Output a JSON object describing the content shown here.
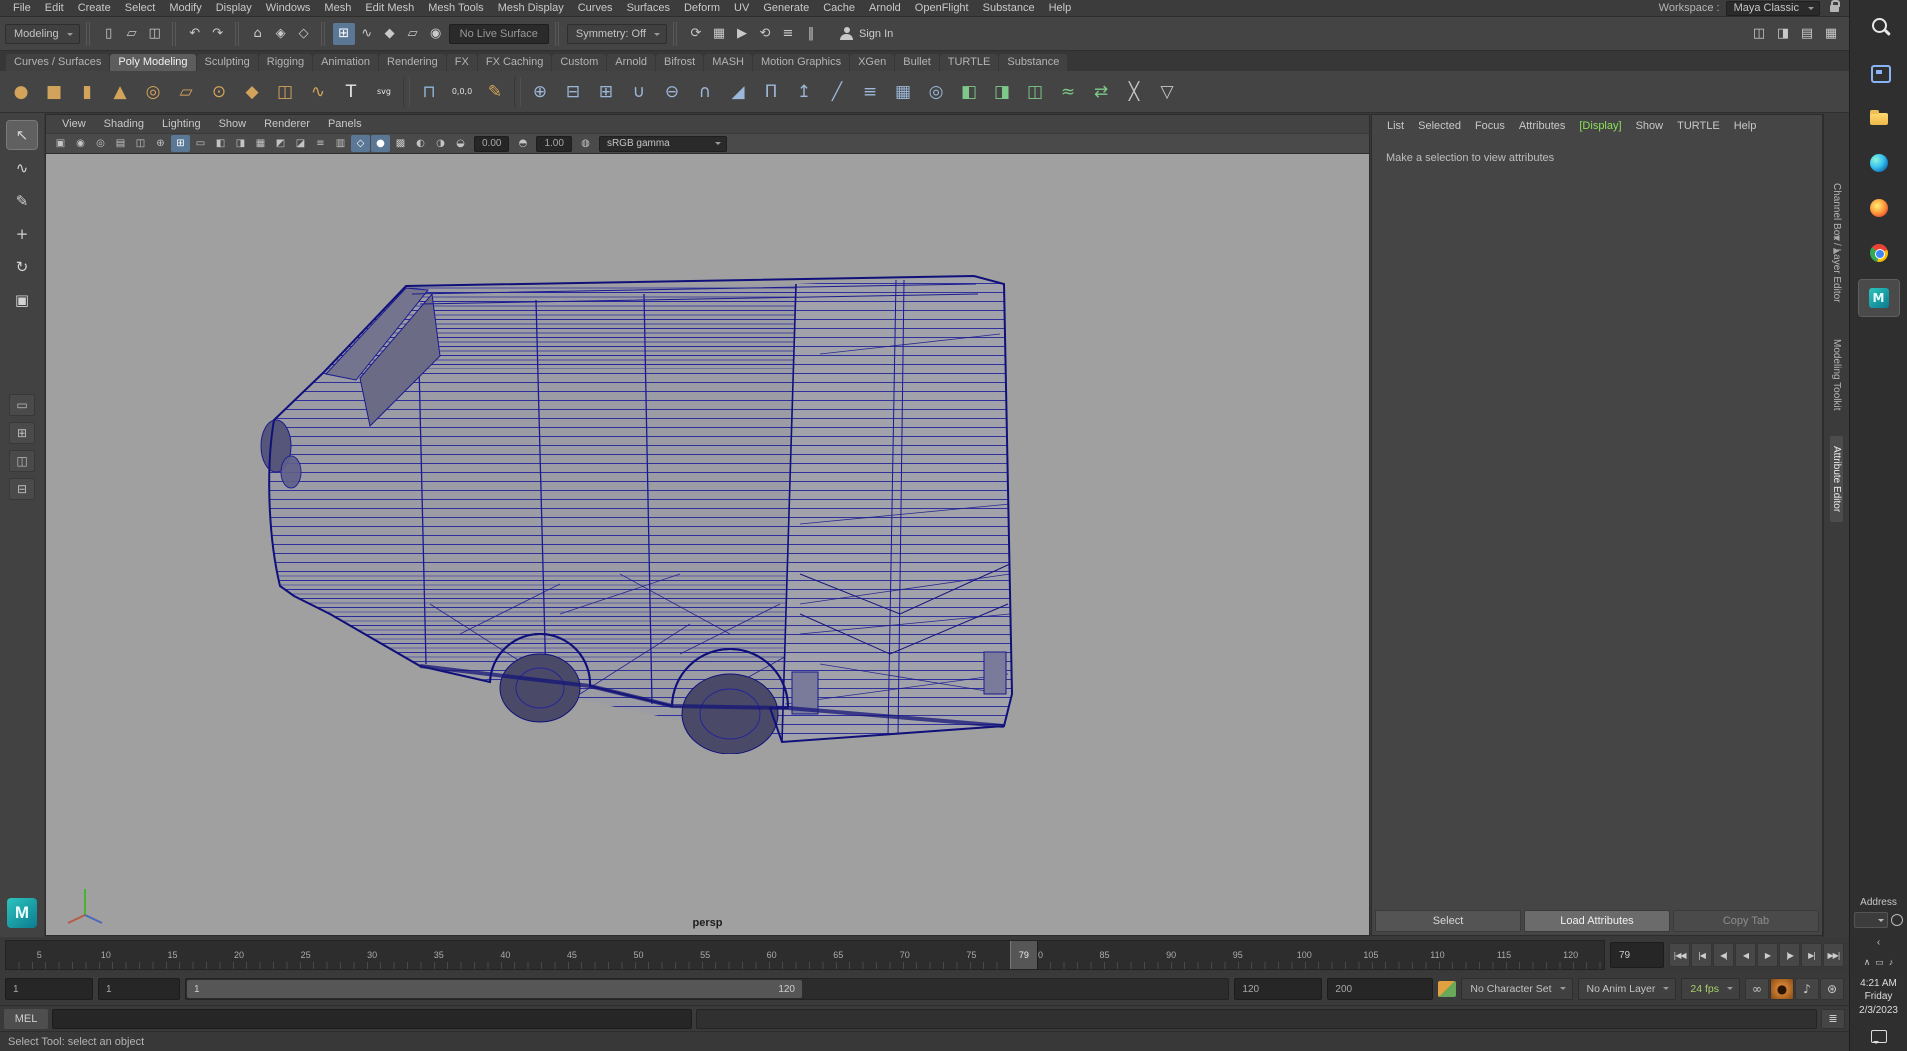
{
  "window": {
    "help_line": "Select Tool: select an object"
  },
  "menu_bar": {
    "items": [
      "File",
      "Edit",
      "Create",
      "Select",
      "Modify",
      "Display",
      "Windows",
      "Mesh",
      "Edit Mesh",
      "Mesh Tools",
      "Mesh Display",
      "Curves",
      "Surfaces",
      "Deform",
      "UV",
      "Generate",
      "Cache",
      "Arnold",
      "OpenFlight",
      "Substance",
      "Help"
    ],
    "workspace_label": "Workspace :",
    "workspace_value": "Maya Classic"
  },
  "status_line": {
    "mode": "Modeling",
    "file_icons": [
      {
        "name": "new-scene-icon",
        "g": "▯"
      },
      {
        "name": "open-scene-icon",
        "g": "▱"
      },
      {
        "name": "save-scene-icon",
        "g": "◫"
      }
    ],
    "history_icons": [
      {
        "name": "undo-icon",
        "g": "↶"
      },
      {
        "name": "redo-icon",
        "g": "↷"
      }
    ],
    "selection_icons": [
      {
        "name": "select-hierarchy-icon",
        "g": "⌂"
      },
      {
        "name": "select-object-icon",
        "g": "◈"
      },
      {
        "name": "select-component-icon",
        "g": "◇"
      }
    ],
    "snap_icons": [
      {
        "name": "snap-grid-icon",
        "g": "⊞",
        "cls": "on"
      },
      {
        "name": "snap-curve-icon",
        "g": "∿"
      },
      {
        "name": "snap-point-icon",
        "g": "◆"
      },
      {
        "name": "snap-plane-icon",
        "g": "▱"
      },
      {
        "name": "make-live-icon",
        "g": "◉"
      }
    ],
    "live_surface": "No Live Surface",
    "symmetry": "Symmetry: Off",
    "render_icons": [
      {
        "name": "construction-history-icon",
        "g": "⟳"
      },
      {
        "name": "render-view-icon",
        "g": "▦"
      },
      {
        "name": "render-frame-icon",
        "g": "▶"
      },
      {
        "name": "ipr-render-icon",
        "g": "⟲"
      },
      {
        "name": "render-settings-icon",
        "g": "≡"
      },
      {
        "name": "pause-icon",
        "g": "‖"
      }
    ],
    "sign_in": "Sign In",
    "panel_toggles": [
      {
        "name": "toggle-modeling-toolkit-icon",
        "g": "◫"
      },
      {
        "name": "toggle-attribute-editor-icon",
        "g": "◨"
      },
      {
        "name": "toggle-tool-settings-icon",
        "g": "▤"
      },
      {
        "name": "toggle-channel-box-icon",
        "g": "▦"
      }
    ]
  },
  "shelf": {
    "tabs": [
      {
        "label": "Curves / Surfaces"
      },
      {
        "label": "Poly Modeling",
        "cls": "active"
      },
      {
        "label": "Sculpting"
      },
      {
        "label": "Rigging"
      },
      {
        "label": "Animation"
      },
      {
        "label": "Rendering"
      },
      {
        "label": "FX"
      },
      {
        "label": "FX Caching"
      },
      {
        "label": "Custom"
      },
      {
        "label": "Arnold"
      },
      {
        "label": "Bifrost"
      },
      {
        "label": "MASH"
      },
      {
        "label": "Motion Graphics"
      },
      {
        "label": "XGen"
      },
      {
        "label": "Bullet"
      },
      {
        "label": "TURTLE"
      },
      {
        "label": "Substance"
      }
    ],
    "items": [
      {
        "name": "poly-sphere-icon",
        "g": "●",
        "c": "#d2a35b"
      },
      {
        "name": "poly-cube-icon",
        "g": "■",
        "c": "#d2a35b"
      },
      {
        "name": "poly-cylinder-icon",
        "g": "▮",
        "c": "#d2a35b"
      },
      {
        "name": "poly-cone-icon",
        "g": "▲",
        "c": "#d2a35b"
      },
      {
        "name": "poly-torus-icon",
        "g": "◎",
        "c": "#d2a35b"
      },
      {
        "name": "poly-plane-icon",
        "g": "▱",
        "c": "#d2a35b"
      },
      {
        "name": "poly-disc-icon",
        "g": "⊙",
        "c": "#d2a35b"
      },
      {
        "name": "poly-platonic-icon",
        "g": "◆",
        "c": "#d2a35b"
      },
      {
        "name": "poly-pipe-icon",
        "g": "◫",
        "c": "#d2a35b"
      },
      {
        "name": "poly-helix-icon",
        "g": "∿",
        "c": "#d2a35b"
      },
      {
        "name": "type-tool-icon",
        "g": "T",
        "c": "#e8e8e8"
      },
      {
        "name": "svg-tool-icon",
        "g": "svg",
        "c": "#e8e8e8",
        "cls": "txt"
      },
      {
        "name": "shelf-separator",
        "g": "",
        "cls": "sepi"
      },
      {
        "name": "make-live-shelf-icon",
        "g": "⊓",
        "c": "#8fb6da"
      },
      {
        "name": "move-to-origin-icon",
        "g": "0,0,0",
        "c": "#e0e0e0",
        "cls": "txt"
      },
      {
        "name": "sculpt-tool-icon",
        "g": "✎",
        "c": "#d2a35b"
      },
      {
        "name": "shelf-separator",
        "g": "",
        "cls": "sepi"
      },
      {
        "name": "combine-icon",
        "g": "⊕",
        "c": "#9db7d8"
      },
      {
        "name": "separate-icon",
        "g": "⊟",
        "c": "#9db7d8"
      },
      {
        "name": "extract-icon",
        "g": "⊞",
        "c": "#9db7d8"
      },
      {
        "name": "boolean-union-icon",
        "g": "∪",
        "c": "#9db7d8"
      },
      {
        "name": "boolean-difference-icon",
        "g": "⊖",
        "c": "#9db7d8"
      },
      {
        "name": "boolean-intersection-icon",
        "g": "∩",
        "c": "#9db7d8"
      },
      {
        "name": "bevel-icon",
        "g": "◢",
        "c": "#9db7d8"
      },
      {
        "name": "bridge-icon",
        "g": "Π",
        "c": "#9db7d8"
      },
      {
        "name": "extrude-icon",
        "g": "↥",
        "c": "#9db7d8"
      },
      {
        "name": "multi-cut-icon",
        "g": "╱",
        "c": "#9db7d8"
      },
      {
        "name": "connect-icon",
        "g": "≡",
        "c": "#9db7d8"
      },
      {
        "name": "quad-draw-icon",
        "g": "▦",
        "c": "#9db7d8"
      },
      {
        "name": "target-weld-icon",
        "g": "◎",
        "c": "#9db7d8"
      },
      {
        "name": "mirror-icon",
        "g": "◧",
        "c": "#7ec98a"
      },
      {
        "name": "flip-icon",
        "g": "◨",
        "c": "#7ec98a"
      },
      {
        "name": "symmetrize-icon",
        "g": "◫",
        "c": "#7ec98a"
      },
      {
        "name": "average-vertices-icon",
        "g": "≈",
        "c": "#7ec98a"
      },
      {
        "name": "transfer-attributes-icon",
        "g": "⇄",
        "c": "#7ec98a"
      },
      {
        "name": "crease-tool-icon",
        "g": "╳",
        "c": "#c8c8c8"
      },
      {
        "name": "reduce-icon",
        "g": "▽",
        "c": "#c8c8c8"
      }
    ]
  },
  "toolbox": {
    "tools": [
      {
        "name": "select-tool",
        "g": "↖",
        "cls": "active"
      },
      {
        "name": "lasso-tool",
        "g": "∿"
      },
      {
        "name": "paint-select-tool",
        "g": "✎"
      },
      {
        "name": "move-tool",
        "g": "+"
      },
      {
        "name": "rotate-tool",
        "g": "↻"
      },
      {
        "name": "scale-tool",
        "g": "▣"
      }
    ],
    "layouts": [
      {
        "name": "layout-single-pane",
        "g": "▭"
      },
      {
        "name": "layout-four-pane",
        "g": "⊞"
      },
      {
        "name": "layout-persp-outliner",
        "g": "◫"
      },
      {
        "name": "layout-stacked",
        "g": "⊟"
      }
    ]
  },
  "panel": {
    "menus": [
      "View",
      "Shading",
      "Lighting",
      "Show",
      "Renderer",
      "Panels"
    ],
    "icons": [
      {
        "name": "select-camera-icon",
        "g": "▣"
      },
      {
        "name": "lock-camera-icon",
        "g": "◉"
      },
      {
        "name": "camera-attributes-icon",
        "g": "◎"
      },
      {
        "name": "bookmarks-icon",
        "g": "▤"
      },
      {
        "name": "image-plane-icon",
        "g": "◫"
      },
      {
        "name": "pan-zoom-icon",
        "g": "⊕"
      },
      {
        "name": "grid-icon",
        "g": "⊞",
        "cls": "on"
      },
      {
        "name": "film-gate-icon",
        "g": "▭"
      },
      {
        "name": "resolution-gate-icon",
        "g": "◧"
      },
      {
        "name": "gate-mask-icon",
        "g": "◨"
      },
      {
        "name": "field-chart-icon",
        "g": "▦"
      },
      {
        "name": "safe-action-icon",
        "g": "◩"
      },
      {
        "name": "safe-title-icon",
        "g": "◪"
      },
      {
        "name": "hud-icon",
        "g": "≡"
      },
      {
        "name": "xray-icon",
        "g": "▥"
      },
      {
        "name": "wireframe-display-icon",
        "g": "◇",
        "cls": "on"
      },
      {
        "name": "shaded-display-icon",
        "g": "●",
        "cls": "on"
      },
      {
        "name": "textured-display-icon",
        "g": "▩"
      },
      {
        "name": "lights-icon",
        "g": "◐"
      },
      {
        "name": "shadows-icon",
        "g": "◑"
      }
    ],
    "exposure_icon": "◒",
    "exposure": "0.00",
    "gamma_icon": "◓",
    "gamma": "1.00",
    "cm_icon": "◍",
    "view_transform": "sRGB gamma",
    "camera": "persp"
  },
  "attribute_editor": {
    "tabs": [
      {
        "label": "List"
      },
      {
        "label": "Selected"
      },
      {
        "label": "Focus"
      },
      {
        "label": "Attributes"
      },
      {
        "label": "[Display]",
        "cls": "green"
      },
      {
        "label": "Show"
      },
      {
        "label": "TURTLE"
      },
      {
        "label": "Help"
      }
    ],
    "message": "Make a selection to view attributes",
    "buttons": [
      {
        "label": "Select",
        "name": "select-button"
      },
      {
        "label": "Load Attributes",
        "name": "load-attributes-button",
        "cls": "primary"
      },
      {
        "label": "Copy Tab",
        "name": "copy-tab-button",
        "cls": "disabled"
      }
    ]
  },
  "side_tabs": [
    {
      "label": "Channel Box / Layer Editor",
      "name": "tab-channel-box-layer-editor"
    },
    {
      "label": "Modeling Toolkit",
      "name": "tab-modeling-toolkit"
    },
    {
      "label": "Attribute Editor",
      "name": "tab-attribute-editor",
      "cls": "active"
    }
  ],
  "timeline": {
    "ticks": [
      5,
      10,
      15,
      20,
      25,
      30,
      35,
      40,
      45,
      50,
      55,
      60,
      65,
      70,
      75,
      80,
      85,
      90,
      95,
      100,
      105,
      110,
      115,
      120
    ],
    "current": "79",
    "playback": [
      {
        "name": "go-to-start-button",
        "g": "|◀◀"
      },
      {
        "name": "step-back-frame-button",
        "g": "|◀"
      },
      {
        "name": "step-back-key-button",
        "g": "◀|"
      },
      {
        "name": "play-backwards-button",
        "g": "◀"
      },
      {
        "name": "play-forward-button",
        "g": "▶"
      },
      {
        "name": "step-forward-key-button",
        "g": "|▶"
      },
      {
        "name": "step-forward-frame-button",
        "g": "▶|"
      },
      {
        "name": "go-to-end-button",
        "g": "▶▶|"
      }
    ]
  },
  "range_slider": {
    "anim_start": "1",
    "play_start": "1",
    "bar_start": "1",
    "bar_end": "120",
    "play_end": "120",
    "anim_end": "200",
    "character_set": "No Character Set",
    "anim_layer": "No Anim Layer",
    "fps": "24 fps",
    "icons": [
      {
        "name": "playback-loop-icon",
        "g": "∞"
      },
      {
        "name": "auto-key-toggle",
        "g": "●",
        "cls": "autokey"
      },
      {
        "name": "sound-icon",
        "g": "♪"
      },
      {
        "name": "animation-preferences-icon",
        "g": "⊛"
      }
    ]
  },
  "command_line": {
    "label": "MEL"
  },
  "taskbar": {
    "apps": [
      {
        "name": "taskbar-search-button",
        "cls": "ti-search"
      },
      {
        "name": "task-view-button",
        "cls": "ti-taskview"
      },
      {
        "name": "file-explorer-button",
        "cls": "ti-folder"
      },
      {
        "name": "edge-button",
        "cls": "ti-edge"
      },
      {
        "name": "firefox-button",
        "cls": "ti-firefox"
      },
      {
        "name": "chrome-button",
        "cls": "ti-chrome"
      },
      {
        "name": "maya-taskbar-button",
        "cls": "ti-maya active"
      }
    ],
    "address_label": "Address",
    "chevron": "‹",
    "tray": [
      {
        "name": "hidden-icons-chevron",
        "g": "∧"
      },
      {
        "name": "display-tray-icon",
        "g": "▭"
      },
      {
        "name": "volume-tray-icon",
        "g": "♪"
      }
    ],
    "clock": {
      "time": "4:21 AM",
      "day": "Friday",
      "date": "2/3/2023"
    }
  }
}
